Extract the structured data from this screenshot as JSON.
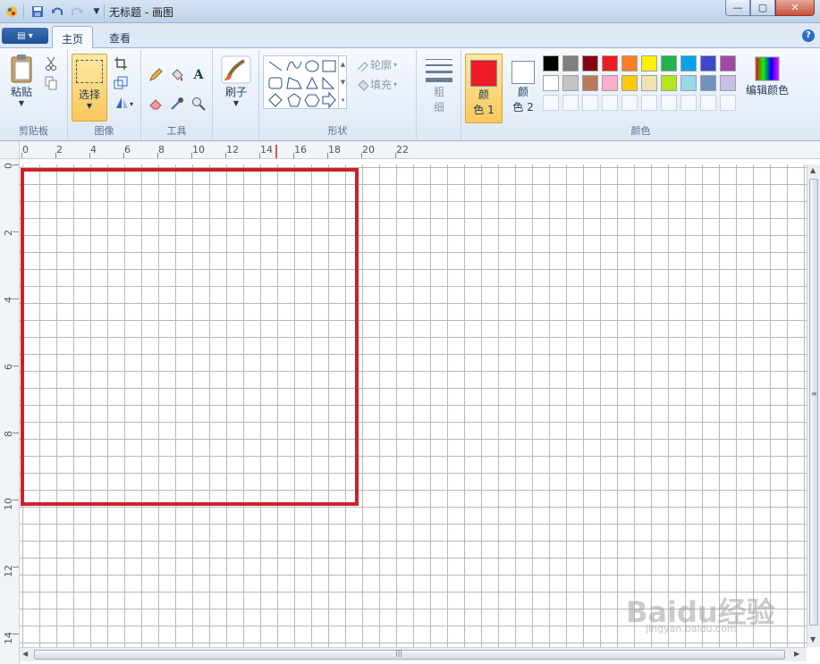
{
  "window": {
    "title": "无标题 - 画图",
    "minimize": "—",
    "maximize": "▢",
    "close": "✕"
  },
  "tabs": {
    "file": "▤ ▾",
    "home": "主页",
    "view": "查看",
    "help": "?"
  },
  "ribbon": {
    "clipboard": {
      "label": "剪贴板",
      "paste": "粘贴"
    },
    "image": {
      "label": "图像",
      "select": "选择"
    },
    "tools": {
      "label": "工具"
    },
    "brushes": {
      "label": "刷子"
    },
    "shapes": {
      "label": "形状",
      "outline": "轮廓",
      "fill": "填充"
    },
    "size": {
      "label1": "粗",
      "label2": "细"
    },
    "colors": {
      "label": "颜色",
      "color1_label": "颜色 1",
      "color1_l1": "颜",
      "color1_l2": "色 1",
      "color2_l1": "颜",
      "color2_l2": "色 2",
      "edit": "编辑颜色",
      "color1": "#ed1c24",
      "color2": "#ffffff",
      "palette": [
        "#000000",
        "#7f7f7f",
        "#880015",
        "#ed1c24",
        "#ff7f27",
        "#fff200",
        "#22b14c",
        "#00a2e8",
        "#3f48cc",
        "#a349a4",
        "#ffffff",
        "#c3c3c3",
        "#b97a57",
        "#ffaec9",
        "#ffc90e",
        "#efe4b0",
        "#b5e61d",
        "#99d9ea",
        "#7092be",
        "#c8bfe7"
      ]
    }
  },
  "ruler": {
    "h": [
      "0",
      "2",
      "4",
      "6",
      "8",
      "10",
      "12",
      "14",
      "16",
      "18",
      "20",
      "22"
    ],
    "v": [
      "0",
      "2",
      "4",
      "6",
      "8",
      "10",
      "12",
      "14"
    ]
  },
  "watermark": {
    "main": "Baidu经验",
    "sub": "jingyan.baidu.com"
  }
}
